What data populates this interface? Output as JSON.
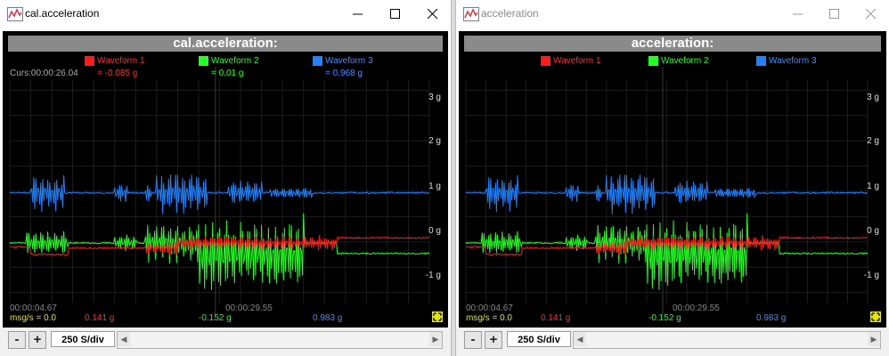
{
  "windows": [
    {
      "title": "cal.acceleration",
      "header": "cal.acceleration:",
      "cursor": "Curs:00:00:26.04",
      "show_values": true,
      "legend": [
        {
          "name": "Waveform 1",
          "color": "#ff1a1a",
          "value": "= -0.085 g"
        },
        {
          "name": "Waveform 2",
          "color": "#22ff22",
          "value": "= 0.01 g"
        },
        {
          "name": "Waveform 3",
          "color": "#1f82ff",
          "value": "= 0.968 g"
        }
      ],
      "y_ticks": [
        "3 g",
        "2 g",
        "1 g",
        "0 g",
        "-1 g"
      ],
      "time_start": "00:00:04.67",
      "time_end": "00:00:29.55",
      "rate_label": "msg/s = 0.0",
      "status_values": [
        "0.141 g",
        "-0.152 g",
        "0.983 g"
      ],
      "minus_label": "-",
      "plus_label": "+",
      "sample_rate": "250 S/div"
    },
    {
      "title": "acceleration",
      "header": "acceleration:",
      "cursor": "",
      "show_values": false,
      "legend": [
        {
          "name": "Waveform 1",
          "color": "#ff1a1a",
          "value": ""
        },
        {
          "name": "Waveform 2",
          "color": "#22ff22",
          "value": ""
        },
        {
          "name": "Waveform 3",
          "color": "#1f82ff",
          "value": ""
        }
      ],
      "y_ticks": [
        "3 g",
        "2 g",
        "1 g",
        "0 g",
        "-1 g"
      ],
      "time_start": "00:00:04.67",
      "time_end": "00:00:29.55",
      "rate_label": "msg/s = 0.0",
      "status_values": [
        "0.141 g",
        "-0.152 g",
        "0.983 g"
      ],
      "minus_label": "-",
      "plus_label": "+",
      "sample_rate": "250 S/div"
    }
  ],
  "chart_data": {
    "type": "line",
    "y_range": [
      -1.2,
      3.2
    ],
    "y_unit": "g",
    "x_range": [
      "00:00:04.67",
      "00:00:29.55"
    ],
    "grid": true,
    "series": [
      {
        "name": "Waveform 1",
        "color": "#ff1a1a",
        "baseline": -0.1
      },
      {
        "name": "Waveform 2",
        "color": "#22ff22",
        "baseline": 0.0
      },
      {
        "name": "Waveform 3",
        "color": "#1f82ff",
        "baseline": 0.97
      }
    ]
  }
}
